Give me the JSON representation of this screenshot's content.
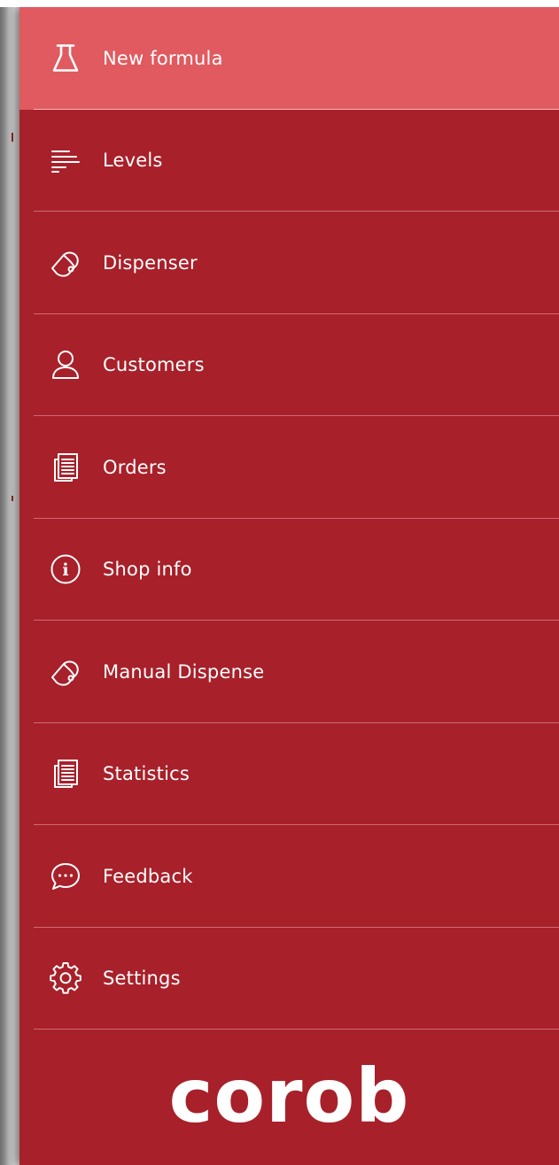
{
  "menu": {
    "items": [
      {
        "label": "New formula",
        "icon": "flask-icon",
        "active": true
      },
      {
        "label": "Levels",
        "icon": "levels-icon",
        "active": false
      },
      {
        "label": "Dispenser",
        "icon": "dispenser-icon",
        "active": false
      },
      {
        "label": "Customers",
        "icon": "user-icon",
        "active": false
      },
      {
        "label": "Orders",
        "icon": "document-icon",
        "active": false
      },
      {
        "label": "Shop info",
        "icon": "info-icon",
        "active": false
      },
      {
        "label": "Manual Dispense",
        "icon": "dispenser-icon",
        "active": false
      },
      {
        "label": "Statistics",
        "icon": "document-icon",
        "active": false
      },
      {
        "label": "Feedback",
        "icon": "chat-icon",
        "active": false
      },
      {
        "label": "Settings",
        "icon": "gear-icon",
        "active": false
      }
    ]
  },
  "brand": {
    "logo_text": "corob"
  },
  "colors": {
    "panel": "#a8202a",
    "active_item": "#e05a5f",
    "text": "#ffffff"
  }
}
